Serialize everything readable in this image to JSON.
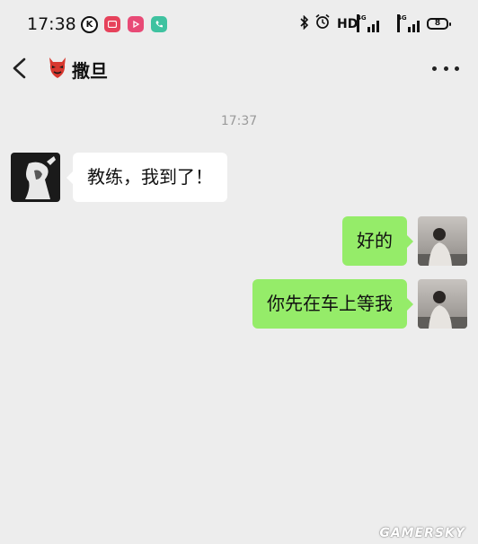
{
  "status_bar": {
    "time": "17:38",
    "app_icons": [
      "k-circle-icon",
      "tv-app-icon",
      "video-play-app-icon",
      "phone-app-icon"
    ],
    "hd_label": "HD",
    "network_label": "4G",
    "battery_level": "8"
  },
  "header": {
    "contact_name": "撒旦"
  },
  "chat": {
    "timestamp": "17:37",
    "messages": [
      {
        "side": "left",
        "text": "教练，我到了！"
      },
      {
        "side": "right",
        "text": "好的"
      },
      {
        "side": "right",
        "text": "你先在车上等我"
      }
    ]
  },
  "watermark": "GAMERSKY",
  "colors": {
    "background": "#ededed",
    "sent_bubble": "#95ec69",
    "received_bubble": "#ffffff"
  }
}
